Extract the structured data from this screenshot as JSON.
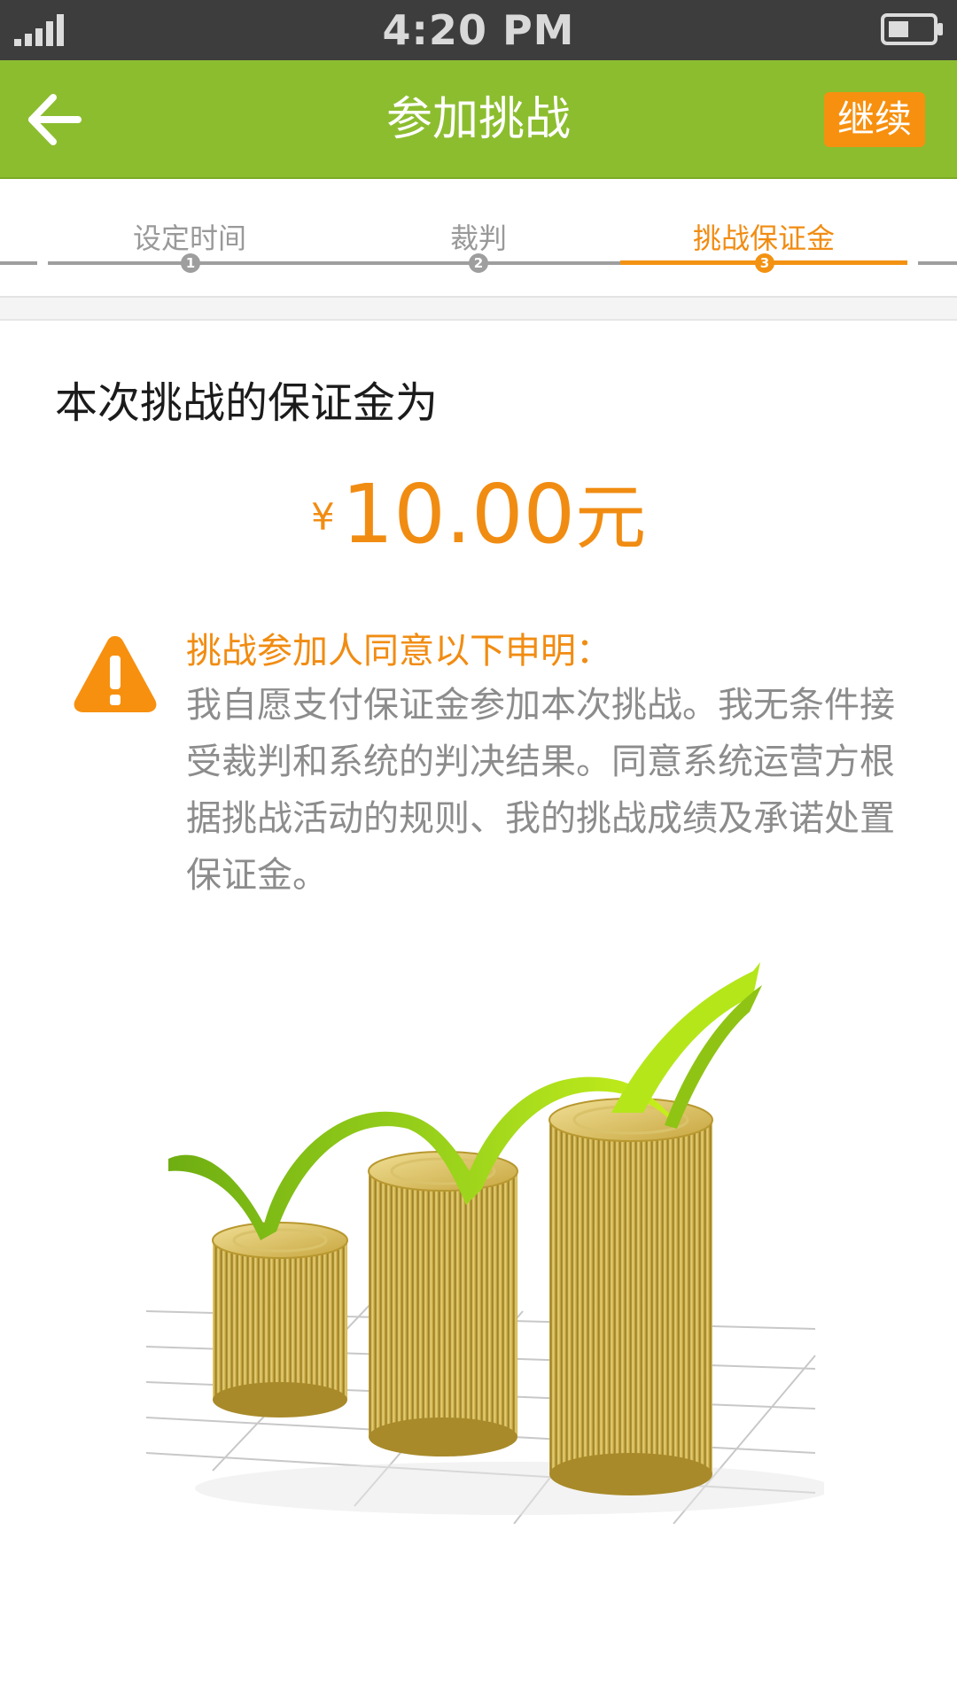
{
  "status_bar": {
    "time": "4:20 PM",
    "signal_icon": "signal-strength-icon",
    "battery_icon": "battery-icon"
  },
  "app_bar": {
    "title": "参加挑战",
    "back_icon": "arrow-left-icon",
    "continue_label": "继续"
  },
  "stepper": {
    "steps": [
      {
        "label": "设定时间",
        "number": "1",
        "active": false
      },
      {
        "label": "裁判",
        "number": "2",
        "active": false
      },
      {
        "label": "挑战保证金",
        "number": "3",
        "active": true
      }
    ]
  },
  "deposit": {
    "title": "本次挑战的保证金为",
    "currency_symbol": "¥",
    "amount": "10.00",
    "unit": "元"
  },
  "declaration": {
    "icon": "warning-icon",
    "title": "挑战参加人同意以下申明：",
    "body": "我自愿支付保证金参加本次挑战。我无条件接受裁判和系统的判决结果。同意系统运营方根据挑战活动的规则、我的挑战成绩及承诺处置保证金。"
  },
  "illustration": {
    "name": "coin-stacks-growth-illustration"
  },
  "colors": {
    "app_bar": "#8cbd2f",
    "accent_orange": "#f18c12",
    "status_bar": "#3d3d3d",
    "inactive_gray": "#9e9e9e",
    "body_text_gray": "#8c8c8c"
  }
}
